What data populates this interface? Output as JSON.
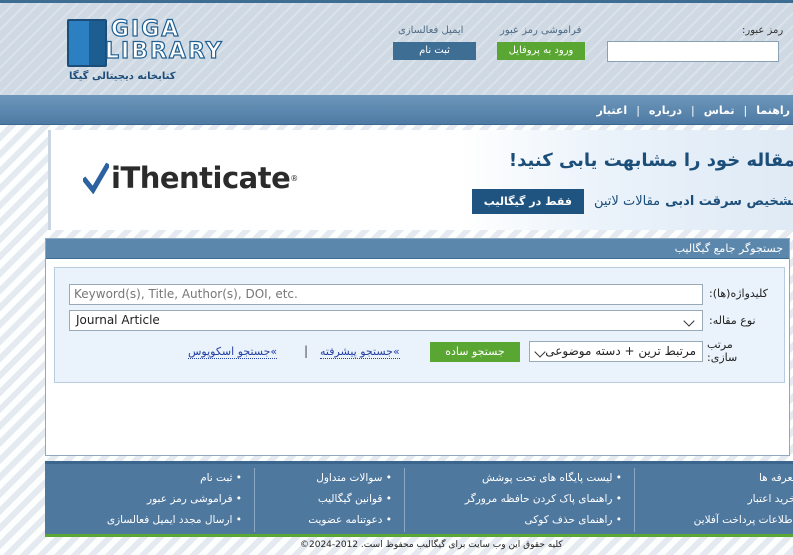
{
  "header": {
    "logo": {
      "line1": "GIGA",
      "line2": "LIBRARY",
      "tagline": "کتابخانه دیجیتالی گیگا"
    },
    "activation_link": "ایمیل فعالسازی",
    "forgot_password_link": "فراموشی رمز عبور",
    "register_button": "ثبت نام",
    "profile_button": "ورود به پروفایل",
    "password_label": "رمز عبور:"
  },
  "nav": {
    "items": [
      "راهنما",
      "تماس",
      "درباره",
      "اعتبار"
    ],
    "separator": "|"
  },
  "banner": {
    "logo_text": "iThenticate",
    "logo_reg": "®",
    "title": "مقاله خود را مشابهت یابی کنید!",
    "sub_bold": "تشخیص سرقت ادبی",
    "sub_text": "مقالات لاتین",
    "pill_label": "فقط در گیگالیب"
  },
  "search": {
    "panel_title": "جستجوگر جامع گیگالیب",
    "keyword_label": "کلیدواژه(ها):",
    "keyword_placeholder": "Keyword(s), Title, Author(s), DOI, etc.",
    "type_label": "نوع مقاله:",
    "type_value": "Journal Article",
    "sort_label_1": "مرتب",
    "sort_label_2": "سازی:",
    "sort_value": "مرتبط ترین + دسته موضوعی",
    "search_button": "جستجو ساده",
    "advanced_link": "»جستجو پیشرفته",
    "pipe": "|",
    "scopus_link": "»جستجو اسکوپوس"
  },
  "footer": {
    "columns": [
      [
        "ثبت نام",
        "فراموشی رمز عبور",
        "ارسال مجدد ایمیل فعالسازی"
      ],
      [
        "سوالات متداول",
        "قوانین گیگالیب",
        "دعوتنامه عضویت"
      ],
      [
        "لیست پایگاه های تحت پوشش",
        "راهنمای پاک کردن حافظه مرورگر",
        "راهنمای حذف کوکی"
      ],
      [
        "تعرفه ها",
        "خرید اعتبار",
        "اطلاعات پرداخت آفلاین"
      ]
    ],
    "copyright": "کلیه حقوق این وب سایت برای گیگالیب محفوظ است. 2012-2024©"
  },
  "colors": {
    "header_top": "#3d6d93",
    "nav": "#5a85ad",
    "green": "#5aa632",
    "blue_button": "#3f6e95",
    "panel_head": "#5c87ad",
    "footer": "#4f789f"
  }
}
